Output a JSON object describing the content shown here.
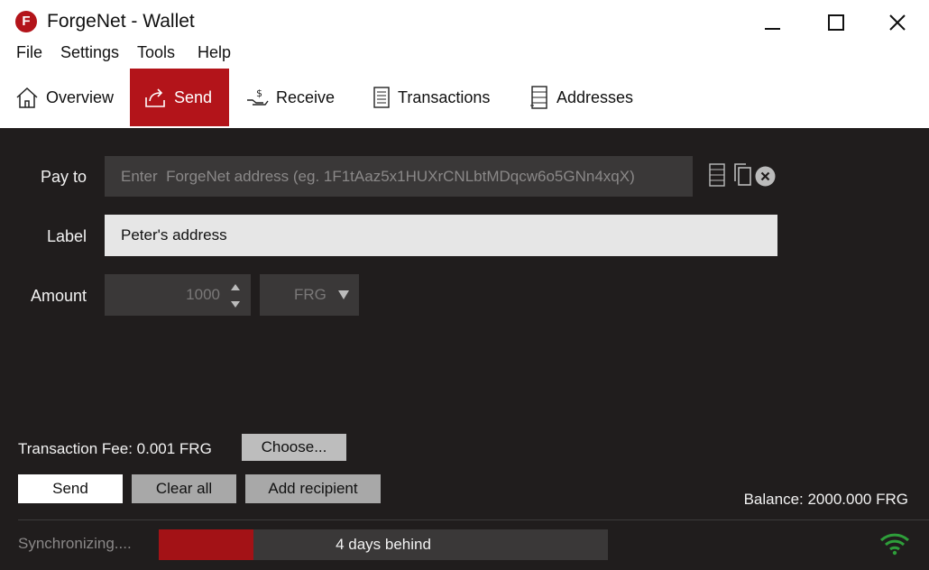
{
  "window": {
    "title": "ForgeNet - Wallet",
    "logo_letter": "F"
  },
  "menu": [
    "File",
    "Settings",
    "Tools",
    "Help"
  ],
  "tabs": [
    {
      "label": "Overview",
      "icon": "home-icon",
      "active": false
    },
    {
      "label": "Send",
      "icon": "send-icon",
      "active": true
    },
    {
      "label": "Receive",
      "icon": "receive-icon",
      "active": false
    },
    {
      "label": "Transactions",
      "icon": "transactions-icon",
      "active": false
    },
    {
      "label": "Addresses",
      "icon": "addresses-icon",
      "active": false
    }
  ],
  "form": {
    "pay_to_label": "Pay to",
    "pay_to_placeholder": "Enter  ForgeNet address (eg. 1F1tAaz5x1HUXrCNLbtMDqcw6o5GNn4xqX)",
    "label_label": "Label",
    "label_value": "Peter's address",
    "amount_label": "Amount",
    "amount_value": "1000",
    "unit_value": "FRG"
  },
  "fee": {
    "text": "Transaction Fee: 0.001 FRG",
    "choose_label": "Choose..."
  },
  "actions": {
    "send_label": "Send",
    "clear_label": "Clear all",
    "add_label": "Add recipient"
  },
  "balance": "Balance: 2000.000 FRG",
  "status": {
    "sync_text": "Synchronizing....",
    "progress_text": "4 days behind",
    "progress_fraction": 0.21
  },
  "colors": {
    "accent": "#b3141a",
    "background": "#201d1d",
    "wifi": "#2e9e3a"
  }
}
